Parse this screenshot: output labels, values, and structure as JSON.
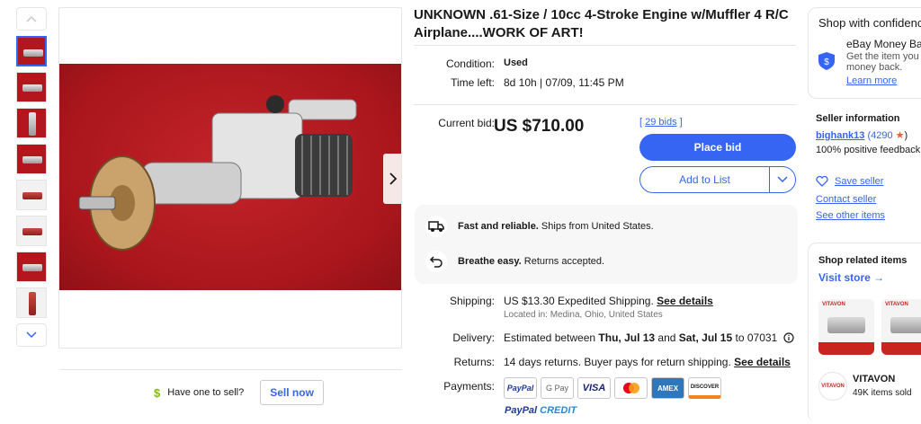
{
  "listing": {
    "title": "UNKNOWN .61-Size / 10cc 4-Stroke Engine w/Muffler 4 R/C Airplane....WORK OF ART!",
    "condition_label": "Condition:",
    "condition_value": "Used",
    "time_left_label": "Time left:",
    "time_left_value": "8d 10h",
    "time_left_sep": "|",
    "time_left_end": "07/09, 11:45 PM",
    "current_bid_label": "Current bid:",
    "current_bid_value": "US $710.00",
    "bids_open": "[",
    "bids_count": "29 bids",
    "bids_close": "]",
    "place_bid": "Place bid",
    "add_to_list": "Add to List"
  },
  "info_box": {
    "shipping_bold": "Fast and reliable.",
    "shipping_text": " Ships from United States.",
    "returns_bold": "Breathe easy.",
    "returns_text": " Returns accepted."
  },
  "details": {
    "shipping_label": "Shipping:",
    "shipping_value": "US $13.30 Expedited Shipping.",
    "shipping_link": "See details",
    "location": "Located in: Medina, Ohio, United States",
    "delivery_label": "Delivery:",
    "delivery_pre": "Estimated between ",
    "delivery_from": "Thu, Jul 13",
    "delivery_and": " and ",
    "delivery_to": "Sat, Jul 15",
    "delivery_post": " to 07031",
    "returns_label": "Returns:",
    "returns_value": "14 days returns. Buyer pays for return shipping.",
    "returns_link": "See details",
    "payments_label": "Payments:",
    "payment_methods": [
      "PayPal",
      "G Pay",
      "VISA",
      "Mastercard",
      "AMEX",
      "DISCOVER"
    ],
    "paypal_credit_a": "PayPal",
    "paypal_credit_b": "CREDIT"
  },
  "sell": {
    "prompt": "Have one to sell?",
    "button": "Sell now"
  },
  "protection": {
    "title": "Shop with confidence",
    "heading": "eBay Money Back",
    "desc_line1": "Get the item you or",
    "desc_line2": "money back.",
    "learn_more": "Learn more"
  },
  "seller": {
    "title": "Seller information",
    "name": "bighank13",
    "feedback_count": "(4290",
    "feedback_close": ")",
    "positive": "100% positive feedback",
    "save": "Save seller",
    "contact": "Contact seller",
    "other_items": "See other items"
  },
  "related": {
    "title": "Shop related items",
    "visit_store": "Visit store",
    "store_name": "VITAVON",
    "items_sold": "49K items sold",
    "brand_mark": "VITAVON"
  },
  "colors": {
    "accent": "#3665f3",
    "photo_bg": "#b3161d",
    "text": "#191919"
  }
}
